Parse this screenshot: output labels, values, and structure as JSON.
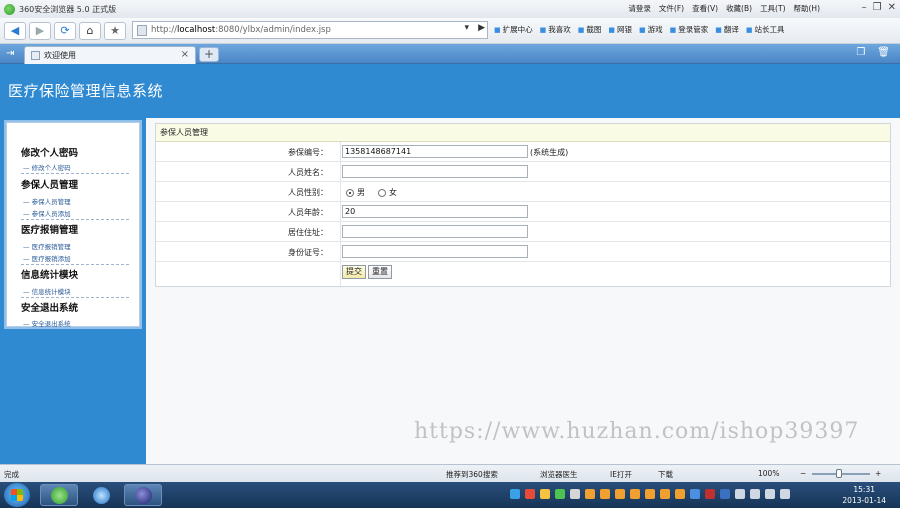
{
  "browser": {
    "title": "360安全浏览器 5.0 正式版",
    "menus": [
      "请登录",
      "文件(F)",
      "查看(V)",
      "收藏(B)",
      "工具(T)",
      "帮助(H)"
    ],
    "url_prefix": "http://",
    "url_host": "localhost",
    "url_rest": ":8080/ylbx/admin/index.jsp",
    "toolbar_items": [
      "扩展中心",
      "我喜欢",
      "截图",
      "网银",
      "游戏",
      "登录管家",
      "翻译",
      "站长工具"
    ],
    "tab_title": "欢迎使用"
  },
  "app": {
    "title": "医疗保险管理信息系统"
  },
  "sidebar": {
    "groups": [
      {
        "label": "修改个人密码",
        "items": [
          "修改个人密码"
        ]
      },
      {
        "label": "参保人员管理",
        "items": [
          "参保人员管理",
          "参保人员添加"
        ]
      },
      {
        "label": "医疗报销管理",
        "items": [
          "医疗报销管理",
          "医疗报销添加"
        ]
      },
      {
        "label": "信息统计模块",
        "items": [
          "信息统计模块"
        ]
      },
      {
        "label": "安全退出系统",
        "items": [
          "安全退出系统"
        ]
      }
    ]
  },
  "form": {
    "header": "参保人员管理",
    "fields": {
      "id_label": "参保编号：",
      "id_value": "1358148687141",
      "id_note": "(系统生成)",
      "name_label": "人员姓名：",
      "name_value": "",
      "gender_label": "人员性别：",
      "gender_male": "男",
      "gender_female": "女",
      "gender_selected": "男",
      "age_label": "人员年龄：",
      "age_value": "20",
      "address_label": "居住住址：",
      "address_value": "",
      "idcard_label": "身份证号：",
      "idcard_value": ""
    },
    "submit_label": "提交",
    "reset_label": "重置"
  },
  "watermark": "https://www.huzhan.com/ishop39397",
  "statusbar": {
    "status": "完成",
    "items": [
      "推荐到360搜索",
      "浏览器医生",
      "IE打开",
      "下载",
      "100%"
    ]
  },
  "taskbar": {
    "time": "15:31",
    "date": "2013-01-14"
  },
  "colors": {
    "header_blue": "#2f8ad1",
    "form_header_bg": "#f9fbe5"
  }
}
